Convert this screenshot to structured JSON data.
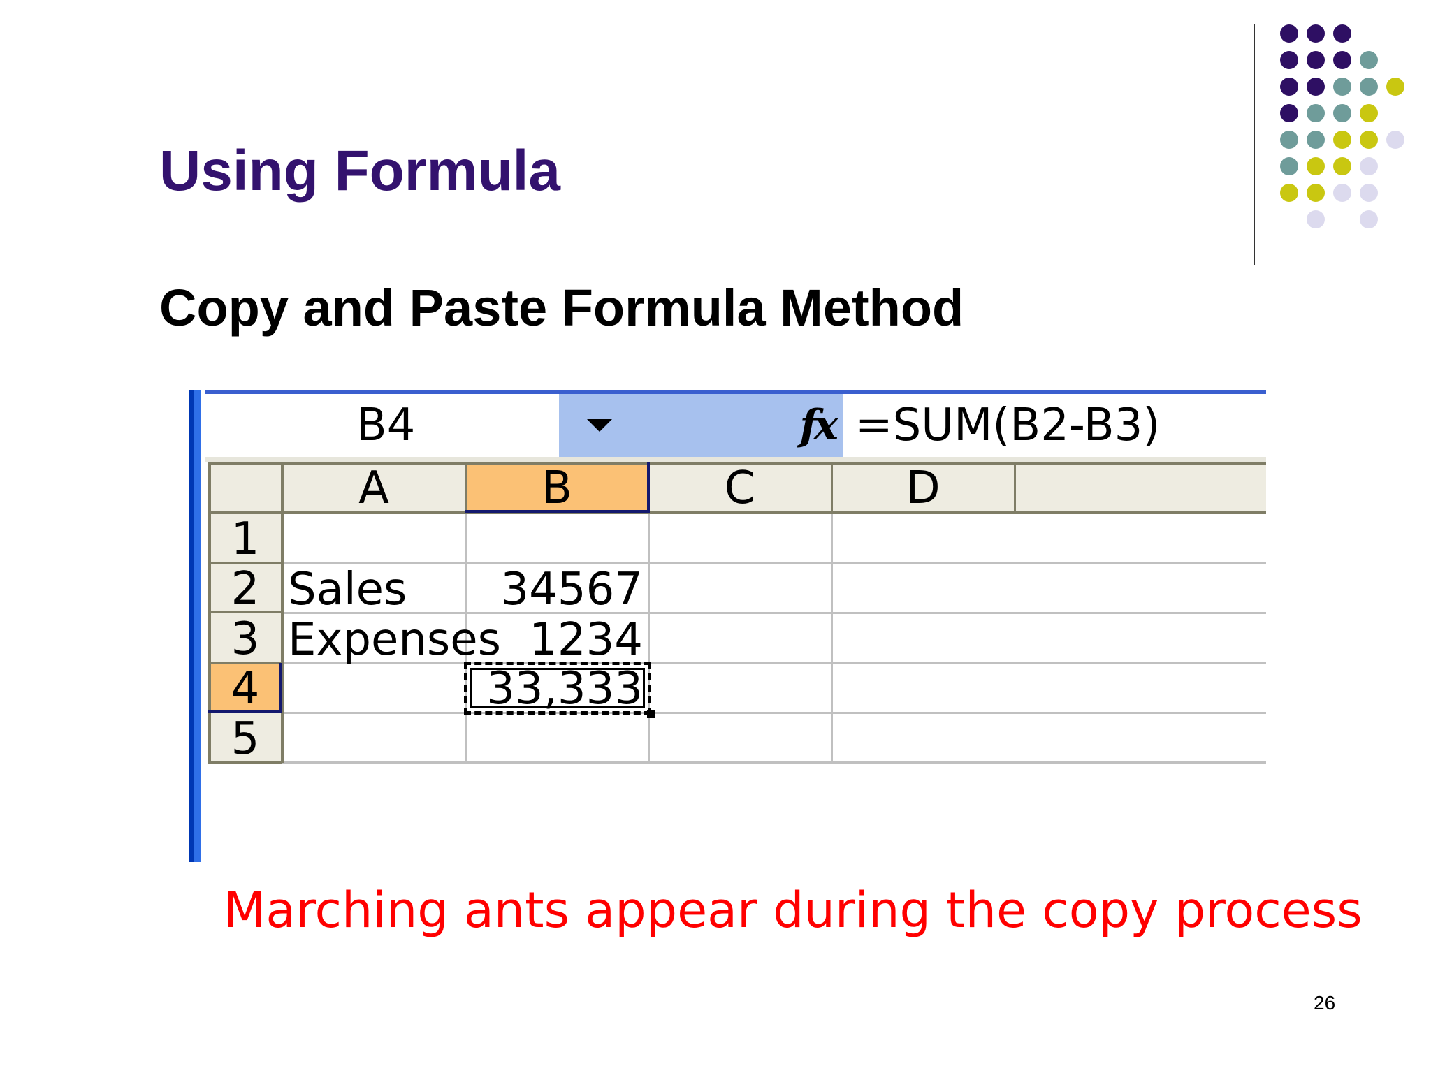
{
  "slide": {
    "title": "Using Formula",
    "subtitle": "Copy and Paste Formula Method",
    "caption": "Marching ants appear during the copy process",
    "page_number": "26"
  },
  "spreadsheet": {
    "name_box": "B4",
    "fx_icon": "fx",
    "formula": "=SUM(B2-B3)",
    "column_headers": [
      "A",
      "B",
      "C",
      "D"
    ],
    "row_headers": [
      "1",
      "2",
      "3",
      "4",
      "5"
    ],
    "selected_column": "B",
    "selected_row": "4",
    "cells": {
      "A2": "Sales",
      "B2": "34567",
      "A3": "Expenses",
      "B3": "1234",
      "B4": "33,333"
    }
  },
  "colors": {
    "title": "#33126e",
    "caption": "#ff0000",
    "header_selected": "#fbc175",
    "dot_purple": "#2e0f63",
    "dot_teal": "#6f9c9a",
    "dot_olive": "#c9c711",
    "dot_lavender": "#dcdaee"
  },
  "decorative_dot_grid": [
    [
      "purple",
      "purple",
      "purple",
      "",
      "",
      ""
    ],
    [
      "purple",
      "purple",
      "purple",
      "teal",
      "",
      ""
    ],
    [
      "purple",
      "purple",
      "teal",
      "teal",
      "olive",
      ""
    ],
    [
      "purple",
      "teal",
      "teal",
      "olive",
      "",
      ""
    ],
    [
      "teal",
      "teal",
      "olive",
      "olive",
      "lavender",
      ""
    ],
    [
      "teal",
      "olive",
      "olive",
      "lavender",
      "",
      ""
    ],
    [
      "olive",
      "olive",
      "lavender",
      "lavender",
      "",
      ""
    ],
    [
      "",
      "lavender",
      "",
      "lavender",
      "",
      ""
    ]
  ]
}
